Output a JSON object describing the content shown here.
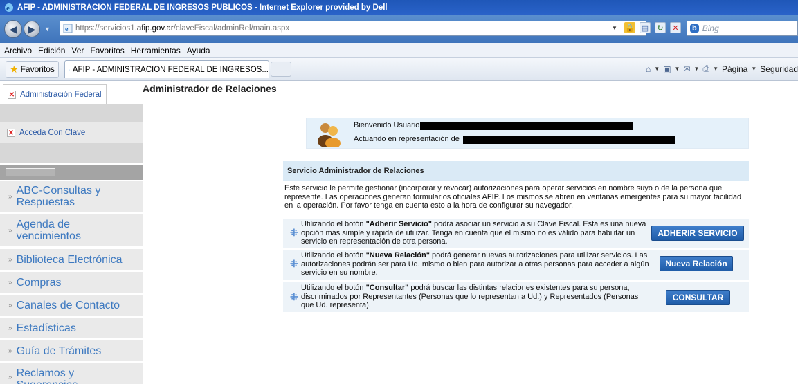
{
  "window": {
    "title": "AFIP - ADMINISTRACION FEDERAL DE INGRESOS PUBLICOS - Internet Explorer provided by Dell"
  },
  "address": {
    "prefix": "https://",
    "host_pre": "servicios1.",
    "host": "afip.gov.ar",
    "path": "/claveFiscal/adminRel/main.aspx"
  },
  "search": {
    "placeholder": "Bing"
  },
  "menu": [
    "Archivo",
    "Edición",
    "Ver",
    "Favoritos",
    "Herramientas",
    "Ayuda"
  ],
  "favbar": {
    "favoritos_label": "Favoritos",
    "tab_title": "AFIP - ADMINISTRACION FEDERAL DE INGRESOS...",
    "pagina_label": "Página",
    "seguridad_label": "Seguridad"
  },
  "leftnav": {
    "admin_federal": "Administración Federal",
    "acceda": "Acceda Con Clave",
    "items": [
      "ABC-Consultas y Respuestas",
      "Agenda de vencimientos",
      "Biblioteca Electrónica",
      "Compras",
      "Canales de Contacto",
      "Estadísticas",
      "Guía de Trámites",
      "Reclamos y Sugerencias"
    ]
  },
  "main": {
    "heading": "Administrador de Relaciones",
    "welcome_line1": "Bienvenido Usuario",
    "welcome_line2": "Actuando en representación de",
    "panel_title": "Servicio Administrador de Relaciones",
    "panel_desc": "Este servicio le permite gestionar (incorporar y revocar) autorizaciones para operar servicios en nombre suyo o de la persona que represente. Las operaciones generan formularios oficiales AFIP. Los mismos se abren en ventanas emergentes para su mayor facilidad en la operación. Por favor tenga en cuenta esto a la hora de configurar su navegador.",
    "rows": [
      {
        "pre": "Utilizando el botón ",
        "bold": "\"Adherir Servicio\"",
        "post": " podrá asociar un servicio a su Clave Fiscal. Esta es una nueva opción más simple y rápida de utilizar. Tenga en cuenta que el mismo no es válido para habilitar un servicio en representación de otra persona.",
        "button": "ADHERIR SERVICIO"
      },
      {
        "pre": "Utilizando el botón ",
        "bold": "\"Nueva Relación\"",
        "post": " podrá generar nuevas autorizaciones para utilizar servicios. Las autorizaciones podrán ser para Ud. mismo o bien para autorizar a otras personas para acceder a algún servicio en su nombre.",
        "button": "Nueva Relación"
      },
      {
        "pre": "Utilizando el botón ",
        "bold": "\"Consultar\"",
        "post": " podrá buscar las distintas relaciones existentes para su persona, discriminados por Representantes (Personas que lo representan a Ud.) y Representados (Personas que Ud. representa).",
        "button": "CONSULTAR"
      }
    ]
  }
}
